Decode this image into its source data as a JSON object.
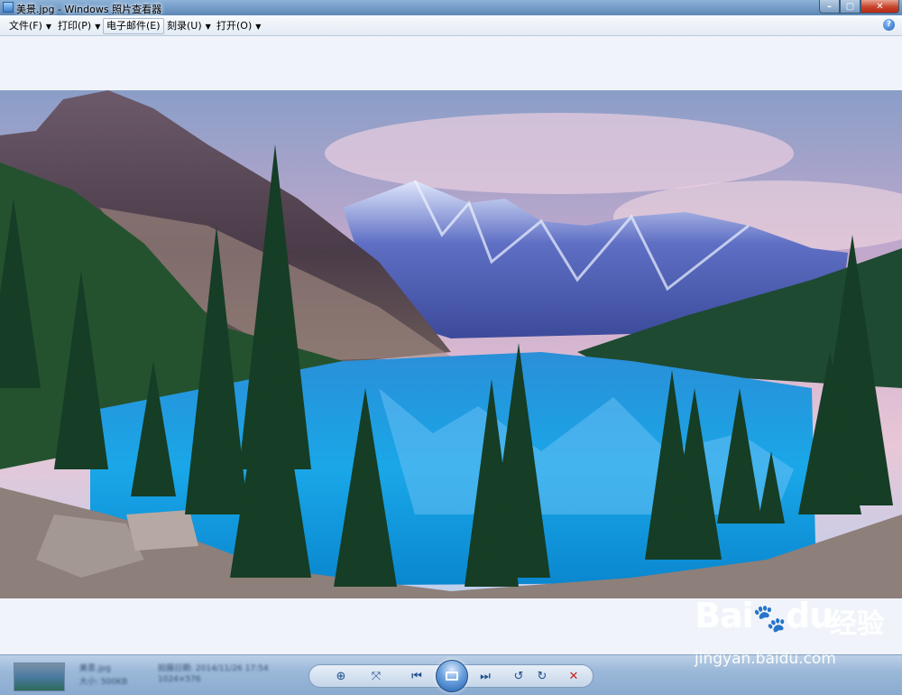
{
  "window": {
    "title": "美景.jpg - Windows 照片查看器",
    "controls": {
      "minimize": "–",
      "maximize": "▢",
      "close": "✕"
    }
  },
  "menubar": {
    "items": [
      {
        "label": "文件(F)",
        "has_dropdown": true
      },
      {
        "label": "打印(P)",
        "has_dropdown": true
      },
      {
        "label": "电子邮件(E)",
        "has_dropdown": false
      },
      {
        "label": "刻录(U)",
        "has_dropdown": true
      },
      {
        "label": "打开(O)",
        "has_dropdown": true
      }
    ],
    "help_icon": "?",
    "caret": "▼"
  },
  "photo": {
    "description_icon": "landscape-photo"
  },
  "bottombar": {
    "info_blurred": [
      "美景.jpg",
      "拍摄日期: 2014/11/26 17:54",
      "大小: 500KB",
      "1024×576"
    ],
    "buttons": {
      "zoom": "⊕",
      "fit": "⤧",
      "prev": "⏮",
      "next": "⏭",
      "rotate_ccw": "↺",
      "rotate_cw": "↻",
      "delete": "✕"
    }
  },
  "watermark": {
    "brand": "Bai",
    "brand2": "du",
    "label": "经验",
    "url": "jingyan.baidu.com"
  },
  "colors": {
    "accent": "#1f5fb0",
    "titlebar": "#6f98c4",
    "delete": "#d02020"
  }
}
